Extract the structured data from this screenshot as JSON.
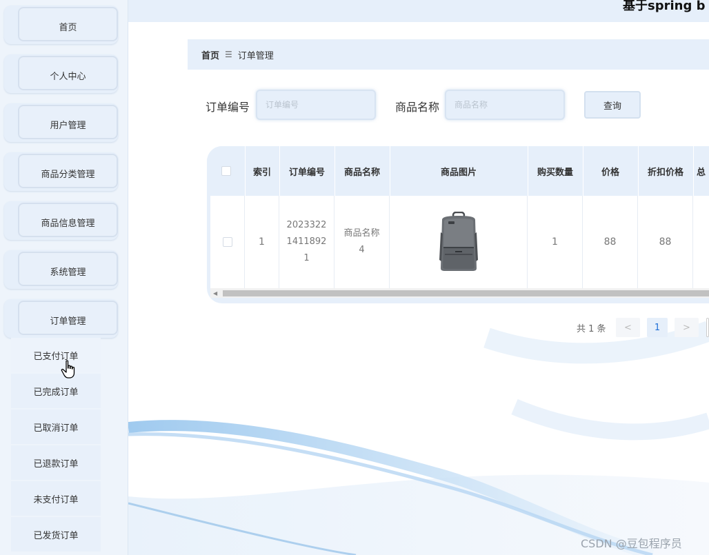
{
  "header": {
    "site_title": "基于spring b"
  },
  "sidebar": {
    "items": [
      {
        "label": "首页"
      },
      {
        "label": "个人中心"
      },
      {
        "label": "用户管理"
      },
      {
        "label": "商品分类管理"
      },
      {
        "label": "商品信息管理"
      },
      {
        "label": "系统管理"
      },
      {
        "label": "订单管理"
      }
    ],
    "sub_items": [
      {
        "label": "已支付订单"
      },
      {
        "label": "已完成订单"
      },
      {
        "label": "已取消订单"
      },
      {
        "label": "已退款订单"
      },
      {
        "label": "未支付订单"
      },
      {
        "label": "已发货订单"
      }
    ]
  },
  "breadcrumb": {
    "home": "首页",
    "separator": "☰",
    "current": "订单管理"
  },
  "search": {
    "order_no_label": "订单编号",
    "order_no_placeholder": "订单编号",
    "product_name_label": "商品名称",
    "product_name_placeholder": "商品名称",
    "query_button": "查询"
  },
  "table": {
    "columns": [
      "索引",
      "订单编号",
      "商品名称",
      "商品图片",
      "购买数量",
      "价格",
      "折扣价格",
      "总"
    ],
    "rows": [
      {
        "index": "1",
        "order_no_lines": [
          "2023322",
          "1411892",
          "1"
        ],
        "product_name_lines": [
          "商品名称",
          "4"
        ],
        "image": "backpack-image",
        "quantity": "1",
        "price": "88",
        "discount_price": "88"
      }
    ]
  },
  "pagination": {
    "total": "共 1 条",
    "prev": "<",
    "page": "1",
    "next": ">"
  },
  "watermark": "CSDN @豆包程序员",
  "colors": {
    "accent": "#e6effa",
    "active_page": "#1d6ed6"
  }
}
